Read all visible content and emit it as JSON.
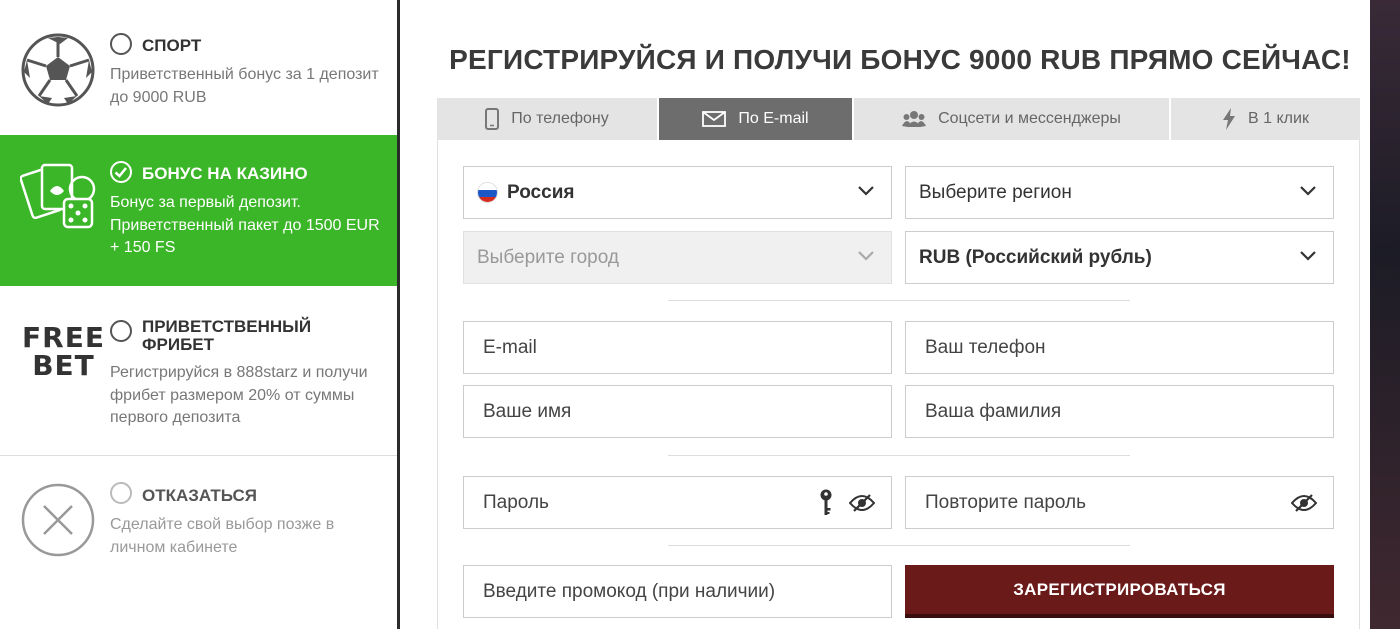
{
  "bonus_options": {
    "sport": {
      "title": "Спорт",
      "description": "Приветственный бонус за 1 депозит до 9000 RUB"
    },
    "casino": {
      "title": "Бонус на казино",
      "description": "Бонус за первый депозит. Приветственный пакет до 1500 EUR + 150 FS",
      "selected": true
    },
    "freebet": {
      "logo_line1": "FREE",
      "logo_line2": "BET",
      "title": "Приветственный фрибет",
      "description": "Регистрируйся в 888starz и получи фрибет размером 20% от суммы первого депозита"
    },
    "decline": {
      "title": "Отказаться",
      "description": "Сделайте свой выбор позже в личном кабинете"
    }
  },
  "form": {
    "headline": "РЕГИСТРИРУЙСЯ И ПОЛУЧИ БОНУС 9000 RUB ПРЯМО СЕЙЧАС!",
    "tabs": [
      {
        "label": "По телефону",
        "icon": "phone-icon"
      },
      {
        "label": "По E-mail",
        "icon": "envelope-icon",
        "active": true
      },
      {
        "label": "Соцсети и мессенджеры",
        "icon": "users-icon"
      },
      {
        "label": "В 1 клик",
        "icon": "lightning-icon"
      }
    ],
    "country": "Россия",
    "region_placeholder": "Выберите регион",
    "city_placeholder": "Выберите город",
    "currency": "RUB (Российский рубль)",
    "email_placeholder": "E-mail",
    "phone_placeholder": "Ваш телефон",
    "first_name_placeholder": "Ваше имя",
    "last_name_placeholder": "Ваша фамилия",
    "password_placeholder": "Пароль",
    "password_repeat_placeholder": "Повторите пароль",
    "promo_placeholder": "Введите промокод (при наличии)",
    "register_label": "ЗАРЕГИСТРИРОВАТЬСЯ"
  },
  "colors": {
    "casino_green": "#3cb629",
    "register_button": "#6b1a1a",
    "active_tab": "#6d6d6d"
  }
}
